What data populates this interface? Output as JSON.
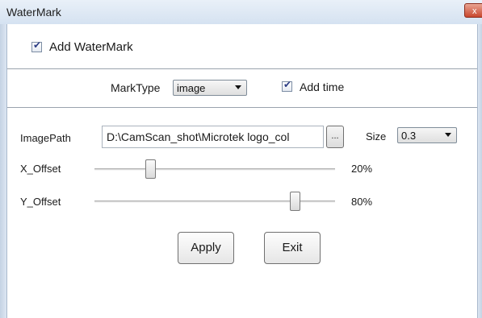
{
  "window": {
    "title": "WaterMark",
    "close_glyph": "x",
    "close_icon": "close-icon"
  },
  "add_watermark": {
    "label": "Add WaterMark",
    "checked": true
  },
  "mark_type": {
    "label": "MarkType",
    "selected": "image"
  },
  "add_time": {
    "label": "Add time",
    "checked": true
  },
  "image_path": {
    "label": "ImagePath",
    "value": "D:\\CamScan_shot\\Microtek logo_col",
    "browse_label": "..."
  },
  "size": {
    "label": "Size",
    "selected": "0.3"
  },
  "x_offset": {
    "label": "X_Offset",
    "value_text": "20%",
    "value": 0.2
  },
  "y_offset": {
    "label": "Y_Offset",
    "value_text": "80%",
    "value": 0.8
  },
  "buttons": {
    "apply": "Apply",
    "exit": "Exit"
  },
  "colors": {
    "checkmark": "#2b3c84",
    "close_button": "#c9472e"
  }
}
